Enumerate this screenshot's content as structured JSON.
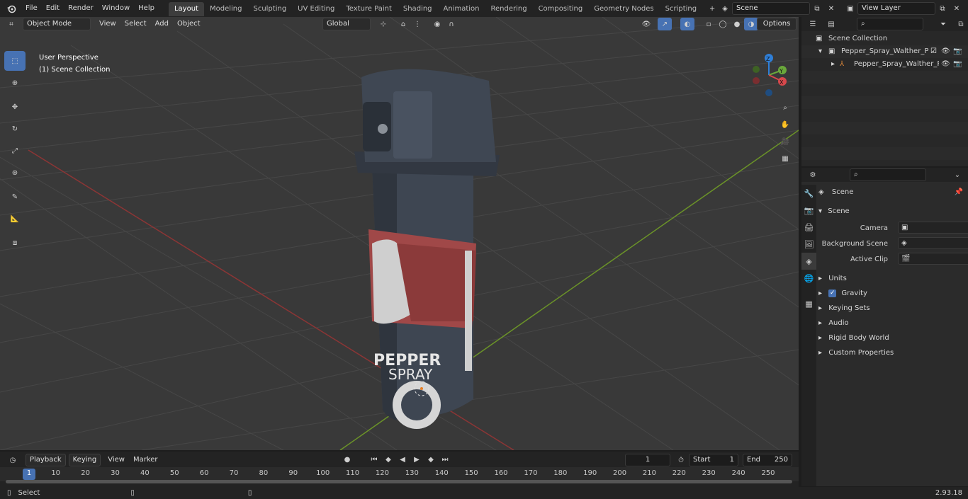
{
  "topbar": {
    "menus": [
      "File",
      "Edit",
      "Render",
      "Window",
      "Help"
    ],
    "workspaces": [
      "Layout",
      "Modeling",
      "Sculpting",
      "UV Editing",
      "Texture Paint",
      "Shading",
      "Animation",
      "Rendering",
      "Compositing",
      "Geometry Nodes",
      "Scripting"
    ],
    "active_workspace": "Layout",
    "scene_name": "Scene",
    "view_layer": "View Layer"
  },
  "viewport": {
    "mode": "Object Mode",
    "menus": [
      "View",
      "Select",
      "Add",
      "Object"
    ],
    "transform_orientation": "Global",
    "options_label": "Options",
    "overlay_title": "User Perspective",
    "overlay_subtitle": "(1) Scene Collection",
    "gizmo_axes": [
      "Z",
      "Y",
      "X"
    ],
    "model_label_line1": "PEPPER",
    "model_label_line2": "SPRAY"
  },
  "outliner": {
    "search_placeholder": "",
    "rows": [
      {
        "label": "Scene Collection"
      },
      {
        "label": "Pepper_Spray_Walther_ProSe"
      },
      {
        "label": "Pepper_Spray_Walther_P"
      }
    ]
  },
  "properties": {
    "context_title": "Scene",
    "panel_title": "Scene",
    "camera_label": "Camera",
    "background_scene_label": "Background Scene",
    "active_clip_label": "Active Clip",
    "subpanels": [
      "Units",
      "Gravity",
      "Keying Sets",
      "Audio",
      "Rigid Body World",
      "Custom Properties"
    ],
    "gravity_checked": true
  },
  "timeline": {
    "menus": [
      "Playback",
      "Keying",
      "View",
      "Marker"
    ],
    "current_frame": "1",
    "start_label": "Start",
    "start_value": "1",
    "end_label": "End",
    "end_value": "250",
    "ticks": [
      "1",
      "10",
      "20",
      "30",
      "40",
      "50",
      "60",
      "70",
      "80",
      "90",
      "100",
      "110",
      "120",
      "130",
      "140",
      "150",
      "160",
      "170",
      "180",
      "190",
      "200",
      "210",
      "220",
      "230",
      "240",
      "250"
    ]
  },
  "statusbar": {
    "left_label": "Select",
    "version": "2.93.18"
  },
  "colors": {
    "accent": "#4772b3",
    "x_axis": "#9b3b3b",
    "y_axis": "#6c9a2a",
    "gizmo_z": "#2f7fd8",
    "gizmo_y": "#6aa83b",
    "gizmo_x": "#d8484c"
  }
}
